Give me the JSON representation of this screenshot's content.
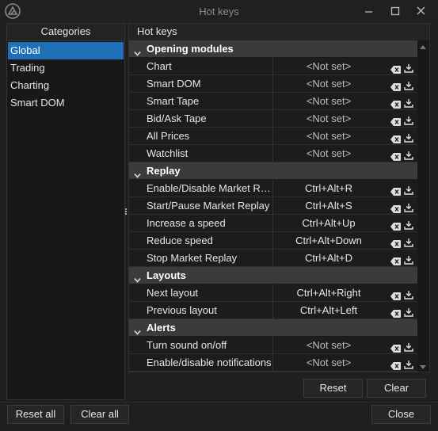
{
  "window": {
    "title": "Hot keys"
  },
  "categories": {
    "header": "Categories",
    "items": [
      {
        "label": "Global",
        "selected": true
      },
      {
        "label": "Trading"
      },
      {
        "label": "Charting"
      },
      {
        "label": "Smart DOM"
      }
    ]
  },
  "hotkeys": {
    "header": "Hot keys",
    "groups": [
      {
        "name": "Opening modules",
        "rows": [
          {
            "name": "Chart",
            "value": "<Not set>"
          },
          {
            "name": "Smart DOM",
            "value": "<Not set>"
          },
          {
            "name": "Smart Tape",
            "value": "<Not set>"
          },
          {
            "name": "Bid/Ask Tape",
            "value": "<Not set>"
          },
          {
            "name": "All Prices",
            "value": "<Not set>"
          },
          {
            "name": "Watchlist",
            "value": "<Not set>"
          }
        ]
      },
      {
        "name": "Replay",
        "rows": [
          {
            "name": "Enable/Disable Market Re...",
            "value": "Ctrl+Alt+R"
          },
          {
            "name": "Start/Pause Market Replay",
            "value": "Ctrl+Alt+S"
          },
          {
            "name": "Increase a speed",
            "value": "Ctrl+Alt+Up"
          },
          {
            "name": "Reduce speed",
            "value": "Ctrl+Alt+Down"
          },
          {
            "name": "Stop Market Replay",
            "value": "Ctrl+Alt+D"
          }
        ]
      },
      {
        "name": "Layouts",
        "rows": [
          {
            "name": "Next layout",
            "value": "Ctrl+Alt+Right"
          },
          {
            "name": "Previous layout",
            "value": "Ctrl+Alt+Left"
          }
        ]
      },
      {
        "name": "Alerts",
        "rows": [
          {
            "name": "Turn sound on/off",
            "value": "<Not set>"
          },
          {
            "name": "Enable/disable notifications",
            "value": "<Not set>"
          }
        ]
      }
    ]
  },
  "buttons": {
    "reset": "Reset",
    "clear": "Clear",
    "reset_all": "Reset all",
    "clear_all": "Clear all",
    "close": "Close"
  },
  "icons": {
    "app": "app-logo-icon",
    "minimize": "minimize-icon",
    "maximize": "maximize-icon",
    "close": "close-icon",
    "clear_row": "backspace-clear-icon",
    "reset_row": "reset-default-icon",
    "group_toggle": "chevron-down-icon"
  },
  "colors": {
    "accent": "#1e6fb5",
    "group_bg": "#3b3b3b",
    "background": "#1f1f1f"
  }
}
